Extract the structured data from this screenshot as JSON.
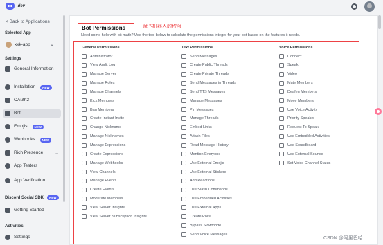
{
  "header": {
    "brand": ".dev"
  },
  "sidebar": {
    "back_label": "< Back to Applications",
    "selected_app_label": "Selected App",
    "app_name": "xxk-app",
    "settings_label": "Settings",
    "items": [
      {
        "label": "General Information",
        "icon": "home-icon"
      },
      {
        "label": "Installation",
        "icon": "gear-icon",
        "badge": "NEW"
      },
      {
        "label": "OAuth2",
        "icon": "wrench-icon"
      },
      {
        "label": "Bot",
        "icon": "bot-icon"
      },
      {
        "label": "Emojis",
        "icon": "emoji-icon",
        "badge": "NEW"
      },
      {
        "label": "Webhooks",
        "icon": "webhook-icon",
        "badge": "NEW"
      },
      {
        "label": "Rich Presence",
        "icon": "presence-icon"
      },
      {
        "label": "App Testers",
        "icon": "testers-icon"
      },
      {
        "label": "App Verification",
        "icon": "verification-icon"
      }
    ],
    "sdk_label": "Discord Social SDK",
    "sdk_badge": "NEW",
    "getting_started": "Getting Started",
    "activities_label": "Activities",
    "activities_settings": "Settings"
  },
  "main": {
    "section_title": "Bot Permissions",
    "annotation": "赋予机器人的权限",
    "help_text": "Need some help with bit math? Use the tool below to calculate the permissions integer for your bot based on the features it needs.",
    "columns": [
      {
        "heading": "General Permissions",
        "items": [
          "Administrator",
          "View Audit Log",
          "Manage Server",
          "Manage Roles",
          "Manage Channels",
          "Kick Members",
          "Ban Members",
          "Create Instant Invite",
          "Change Nickname",
          "Manage Nicknames",
          "Manage Expressions",
          "Create Expressions",
          "Manage Webhooks",
          "View Channels",
          "Manage Events",
          "Create Events",
          "Moderate Members",
          "View Server Insights",
          "View Server Subscription Insights"
        ]
      },
      {
        "heading": "Text Permissions",
        "items": [
          "Send Messages",
          "Create Public Threads",
          "Create Private Threads",
          "Send Messages in Threads",
          "Send TTS Messages",
          "Manage Messages",
          "Pin Messages",
          "Manage Threads",
          "Embed Links",
          "Attach Files",
          "Read Message History",
          "Mention Everyone",
          "Use External Emojis",
          "Use External Stickers",
          "Add Reactions",
          "Use Slash Commands",
          "Use Embedded Activities",
          "Use External Apps",
          "Create Polls",
          "Bypass Slowmode",
          "Send Voice Messages"
        ]
      },
      {
        "heading": "Voice Permissions",
        "items": [
          "Connect",
          "Speak",
          "Video",
          "Mute Members",
          "Deafen Members",
          "Move Members",
          "Use Voice Activity",
          "Priority Speaker",
          "Request To Speak",
          "Use Embedded Activities",
          "Use Soundboard",
          "Use External Sounds",
          "Set Voice Channel Status"
        ]
      }
    ]
  },
  "watermark": "CSDN @阿里巴哈",
  "colors": {
    "accent": "#5865f2",
    "annotation": "#ed4245"
  }
}
